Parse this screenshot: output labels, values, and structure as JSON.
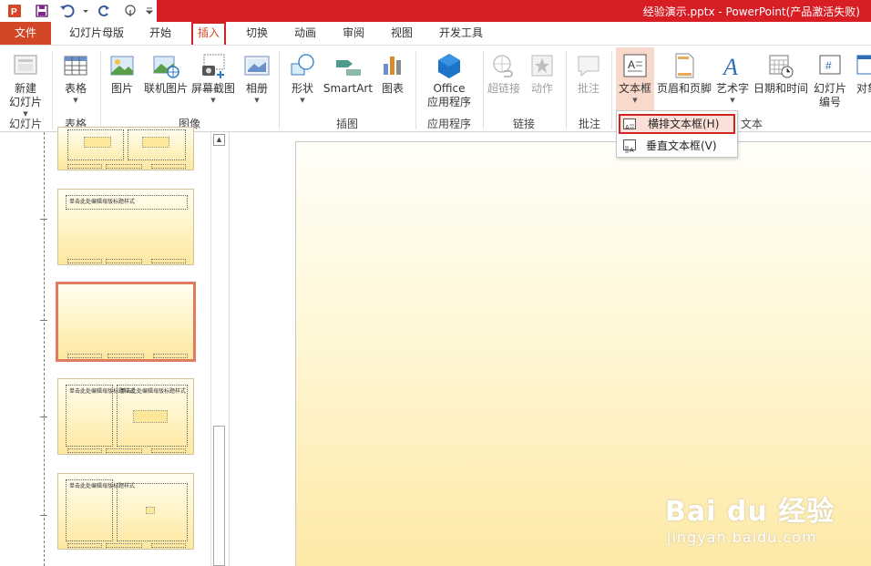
{
  "window": {
    "title": "经验演示.pptx -   PowerPoint(产品激活失败)"
  },
  "quick_access": {
    "icons": [
      "powerpoint-logo-icon",
      "save-icon",
      "undo-icon",
      "redo-icon",
      "touch-mode-icon"
    ]
  },
  "tabs": [
    {
      "label": "文件"
    },
    {
      "label": "幻灯片母版"
    },
    {
      "label": "开始"
    },
    {
      "label": "插入"
    },
    {
      "label": "切换"
    },
    {
      "label": "动画"
    },
    {
      "label": "审阅"
    },
    {
      "label": "视图"
    },
    {
      "label": "开发工具"
    }
  ],
  "ribbon": {
    "buttons": {
      "new_slide": "新建\n幻灯片",
      "table": "表格",
      "picture": "图片",
      "online_picture": "联机图片",
      "screenshot": "屏幕截图",
      "album": "相册",
      "shapes": "形状",
      "smartart": "SmartArt",
      "chart": "图表",
      "office_apps": "Office\n应用程序",
      "hyperlink": "超链接",
      "action": "动作",
      "comment": "批注",
      "textbox": "文本框",
      "header_footer": "页眉和页脚",
      "wordart": "艺术字",
      "datetime": "日期和时间",
      "slide_number": "幻灯片\n编号",
      "object": "对象"
    },
    "groups": {
      "slides": "幻灯片",
      "tables": "表格",
      "images": "图像",
      "illustrations": "插图",
      "apps": "应用程序",
      "links": "链接",
      "comments": "批注",
      "text": "文本"
    }
  },
  "textbox_menu": {
    "items": [
      {
        "label": "横排文本框(H)",
        "selected": true
      },
      {
        "label": "垂直文本框(V)",
        "selected": false
      }
    ]
  },
  "thumbnails": {
    "title_text": "单击此处编辑母版标题样式"
  },
  "watermark": {
    "brand": "Bai du 经验",
    "url": "jingyan.baidu.com"
  },
  "colors": {
    "title_bar": "#d71e25",
    "file_tab": "#d24726",
    "highlight_outline": "#d02323",
    "selected_thumb_border": "#e07b60",
    "slide_gradient_top": "#fffef8",
    "slide_gradient_bottom": "#fde9a6"
  }
}
